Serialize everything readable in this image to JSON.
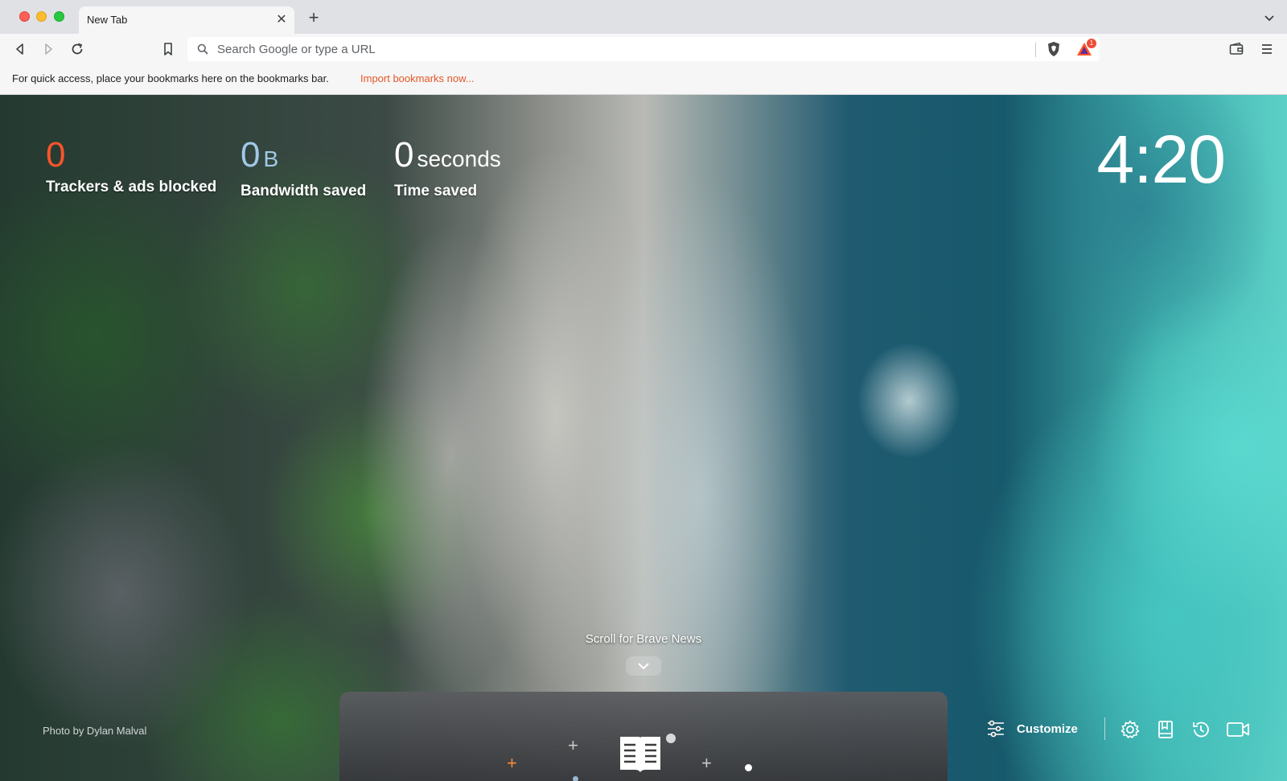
{
  "window": {
    "tabs": [
      {
        "title": "New Tab"
      }
    ]
  },
  "toolbar": {
    "omnibox_placeholder": "Search Google or type a URL",
    "rewards_badge": "1"
  },
  "bookmarks_bar": {
    "message": "For quick access, place your bookmarks here on the bookmarks bar.",
    "import_link": "Import bookmarks now..."
  },
  "stats": {
    "trackers": {
      "value": "0",
      "label": "Trackers & ads blocked"
    },
    "bandwidth": {
      "value": "0",
      "unit": "B",
      "label": "Bandwidth saved"
    },
    "time": {
      "value": "0",
      "unit": "seconds",
      "label": "Time saved"
    }
  },
  "clock": {
    "time": "4:20"
  },
  "news": {
    "scroll_label": "Scroll for Brave News"
  },
  "photo_credit": "Photo by Dylan Malval",
  "controls": {
    "customize_label": "Customize"
  },
  "colors": {
    "brave_orange": "#fb542b",
    "link_orange": "#e65627",
    "bandwidth_blue": "#a0c8e6"
  },
  "icons": [
    "back-icon",
    "forward-icon",
    "reload-icon",
    "bookmark-icon",
    "search-icon",
    "brave-shield-icon",
    "brave-rewards-icon",
    "wallet-icon",
    "menu-icon",
    "customize-sliders-icon",
    "settings-gear-icon",
    "bookmarks-icon",
    "history-icon",
    "video-camera-icon"
  ]
}
